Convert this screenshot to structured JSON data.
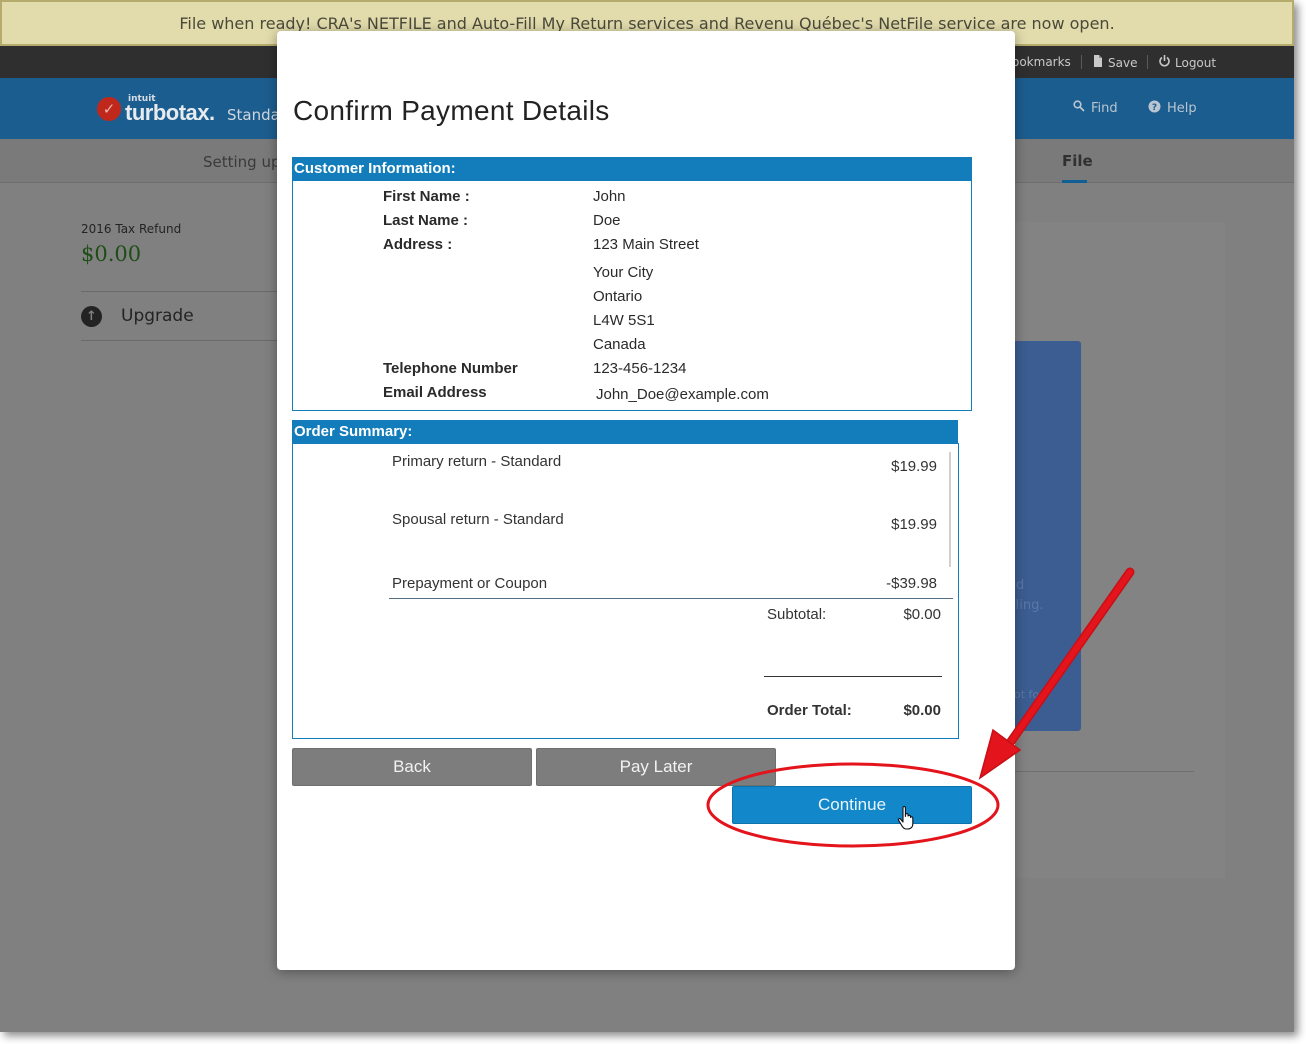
{
  "banner": {
    "text": "File when ready! CRA's NETFILE and Auto-Fill My Return services and Revenu Québec's NetFile service are now open."
  },
  "utility_bar": {
    "bookmarks_label": "ookmarks",
    "save_label": "Save",
    "logout_label": "Logout"
  },
  "header": {
    "brand_intuit": "intuit",
    "brand_name": "turbotax.",
    "edition": "Standa",
    "find_label": "Find",
    "help_label": "Help"
  },
  "steps": {
    "first": "Setting up",
    "active": "File"
  },
  "sidebar": {
    "refund_label": "2016 Tax Refund",
    "refund_value": "$0.00",
    "upgrade_label": "Upgrade"
  },
  "background_card": {
    "fragment_1": "d",
    "fragment_2": "iling.",
    "fragment_3": "ot fo"
  },
  "modal": {
    "title": "Confirm Payment Details",
    "customer_header": "Customer Information:",
    "customer": {
      "first_name_label": "First Name :",
      "first_name": "John",
      "last_name_label": "Last Name :",
      "last_name": "Doe",
      "address_label": "Address :",
      "address_street": "123 Main Street",
      "address_city": "Your City",
      "address_province": "Ontario",
      "address_postal": "L4W 5S1",
      "address_country": "Canada",
      "phone_label": "Telephone Number",
      "phone": "123-456-1234",
      "email_label": "Email Address",
      "email": "John_Doe@example.com"
    },
    "order_header": "Order Summary:",
    "order": {
      "items": [
        {
          "name": "Primary return - Standard",
          "price": "$19.99"
        },
        {
          "name": "Spousal return - Standard",
          "price": "$19.99"
        },
        {
          "name": "Prepayment or Coupon",
          "price": "-$39.98"
        }
      ],
      "subtotal_label": "Subtotal:",
      "subtotal": "$0.00",
      "total_label": "Order Total:",
      "total": "$0.00"
    },
    "buttons": {
      "back": "Back",
      "pay_later": "Pay Later",
      "continue": "Continue"
    }
  },
  "colors": {
    "accent_blue": "#137dbc",
    "button_blue": "#1287c9",
    "annotation_red": "#e3141b"
  }
}
